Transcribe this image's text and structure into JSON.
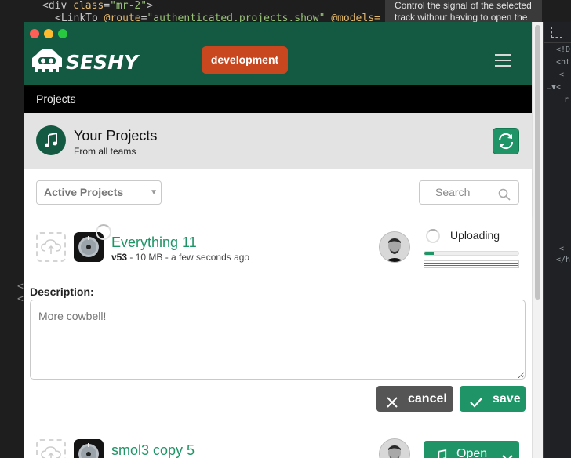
{
  "editor": {
    "line1_a": "<div ",
    "line1_attr": "class",
    "line1_eq": "=",
    "line1_val": "\"mr-2\"",
    "line1_end": ">",
    "line2_a": "<LinkTo ",
    "line2_attr": "@route",
    "line2_eq": "=",
    "line2_val": "\"authenticated.projects.show\"",
    "line2_rest": " @models=",
    "left_marks": [
      "<",
      "<"
    ]
  },
  "tooltip": {
    "text": "Control the signal of the selected track without having to open the"
  },
  "devtools": {
    "lines": [
      "<!D",
      "<ht",
      "<",
      "…▼<",
      "r",
      "<",
      "</h"
    ]
  },
  "app": {
    "logo_text": "SESHY",
    "env_badge": "development",
    "breadcrumb": "Projects",
    "header": {
      "title": "Your Projects",
      "subtitle": "From all teams"
    },
    "filter": {
      "selected": "Active Projects",
      "search_placeholder": "Search"
    },
    "projects": [
      {
        "name": "Everything 11",
        "version": "v53",
        "meta": " - 10 MB - a few seconds ago",
        "status": "Uploading",
        "upload_progress": 0.1,
        "description_label": "Description:",
        "description_placeholder": "More cowbell!",
        "cancel_label": "cancel",
        "save_label": "save"
      },
      {
        "name": "smol3 copy 5",
        "open_label": "Open"
      }
    ]
  },
  "colors": {
    "brand_green": "#145a43",
    "accent_green": "#1f9466",
    "badge_orange": "#c8471f"
  }
}
